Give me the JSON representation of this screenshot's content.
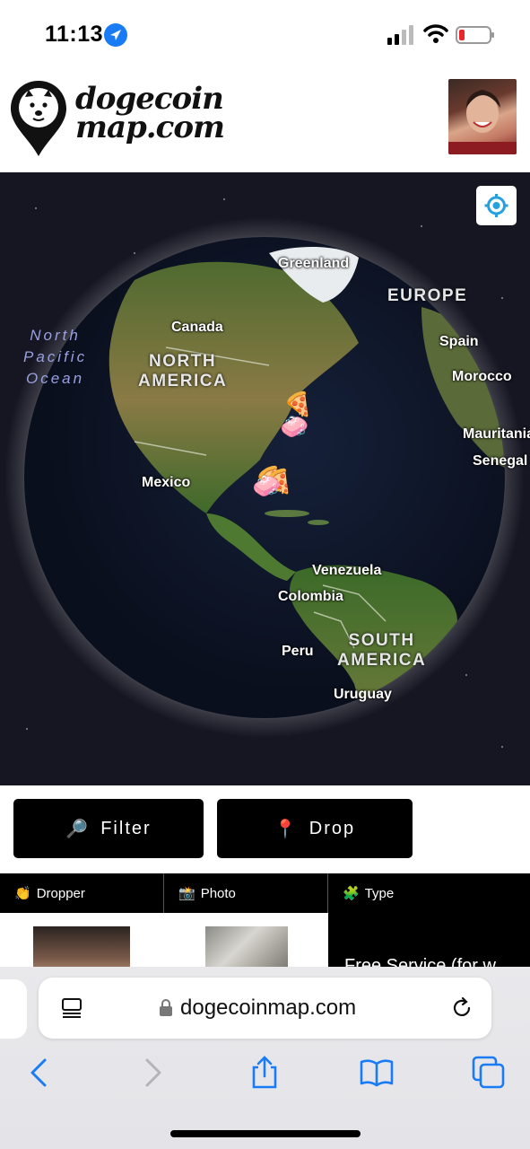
{
  "status_bar": {
    "time": "11:13",
    "icons": [
      "location-arrow-icon",
      "cellular-signal-icon",
      "wifi-icon",
      "battery-low-icon"
    ]
  },
  "header": {
    "logo_line1": "dogecoin",
    "logo_line2": "map.com",
    "logo_icon": "doge-pin-icon",
    "avatar": "user-avatar"
  },
  "map": {
    "locate_button_icon": "locate-icon",
    "regions": [
      "NORTH\nAMERICA",
      "SOUTH\nAMERICA",
      "EUROPE"
    ],
    "ocean": "North\nPacific\nOcean",
    "labels": [
      "Greenland",
      "Canada",
      "Spain",
      "Morocco",
      "Mauritania",
      "Senegal",
      "Mexico",
      "Venezuela",
      "Colombia",
      "Peru",
      "Uruguay"
    ],
    "markers": [
      "pizza-icon",
      "pizza-icon",
      "pizza-icon",
      "soap-icon",
      "soap-icon"
    ]
  },
  "actions": {
    "filter_label": "Filter",
    "filter_icon": "magnifier-icon",
    "drop_label": "Drop",
    "drop_icon": "pushpin-icon"
  },
  "table": {
    "columns": [
      {
        "label": "Dropper",
        "icon": "clapping-hands-icon"
      },
      {
        "label": "Photo",
        "icon": "camera-flash-icon"
      },
      {
        "label": "Type",
        "icon": "puzzle-piece-icon"
      }
    ],
    "row_type_text": "Free Service (for w"
  },
  "browser": {
    "url": "dogecoinmap.com",
    "icons": [
      "reader-icon",
      "lock-icon",
      "reload-icon",
      "back-icon",
      "forward-icon",
      "share-icon",
      "bookmarks-icon",
      "tabs-icon"
    ]
  }
}
